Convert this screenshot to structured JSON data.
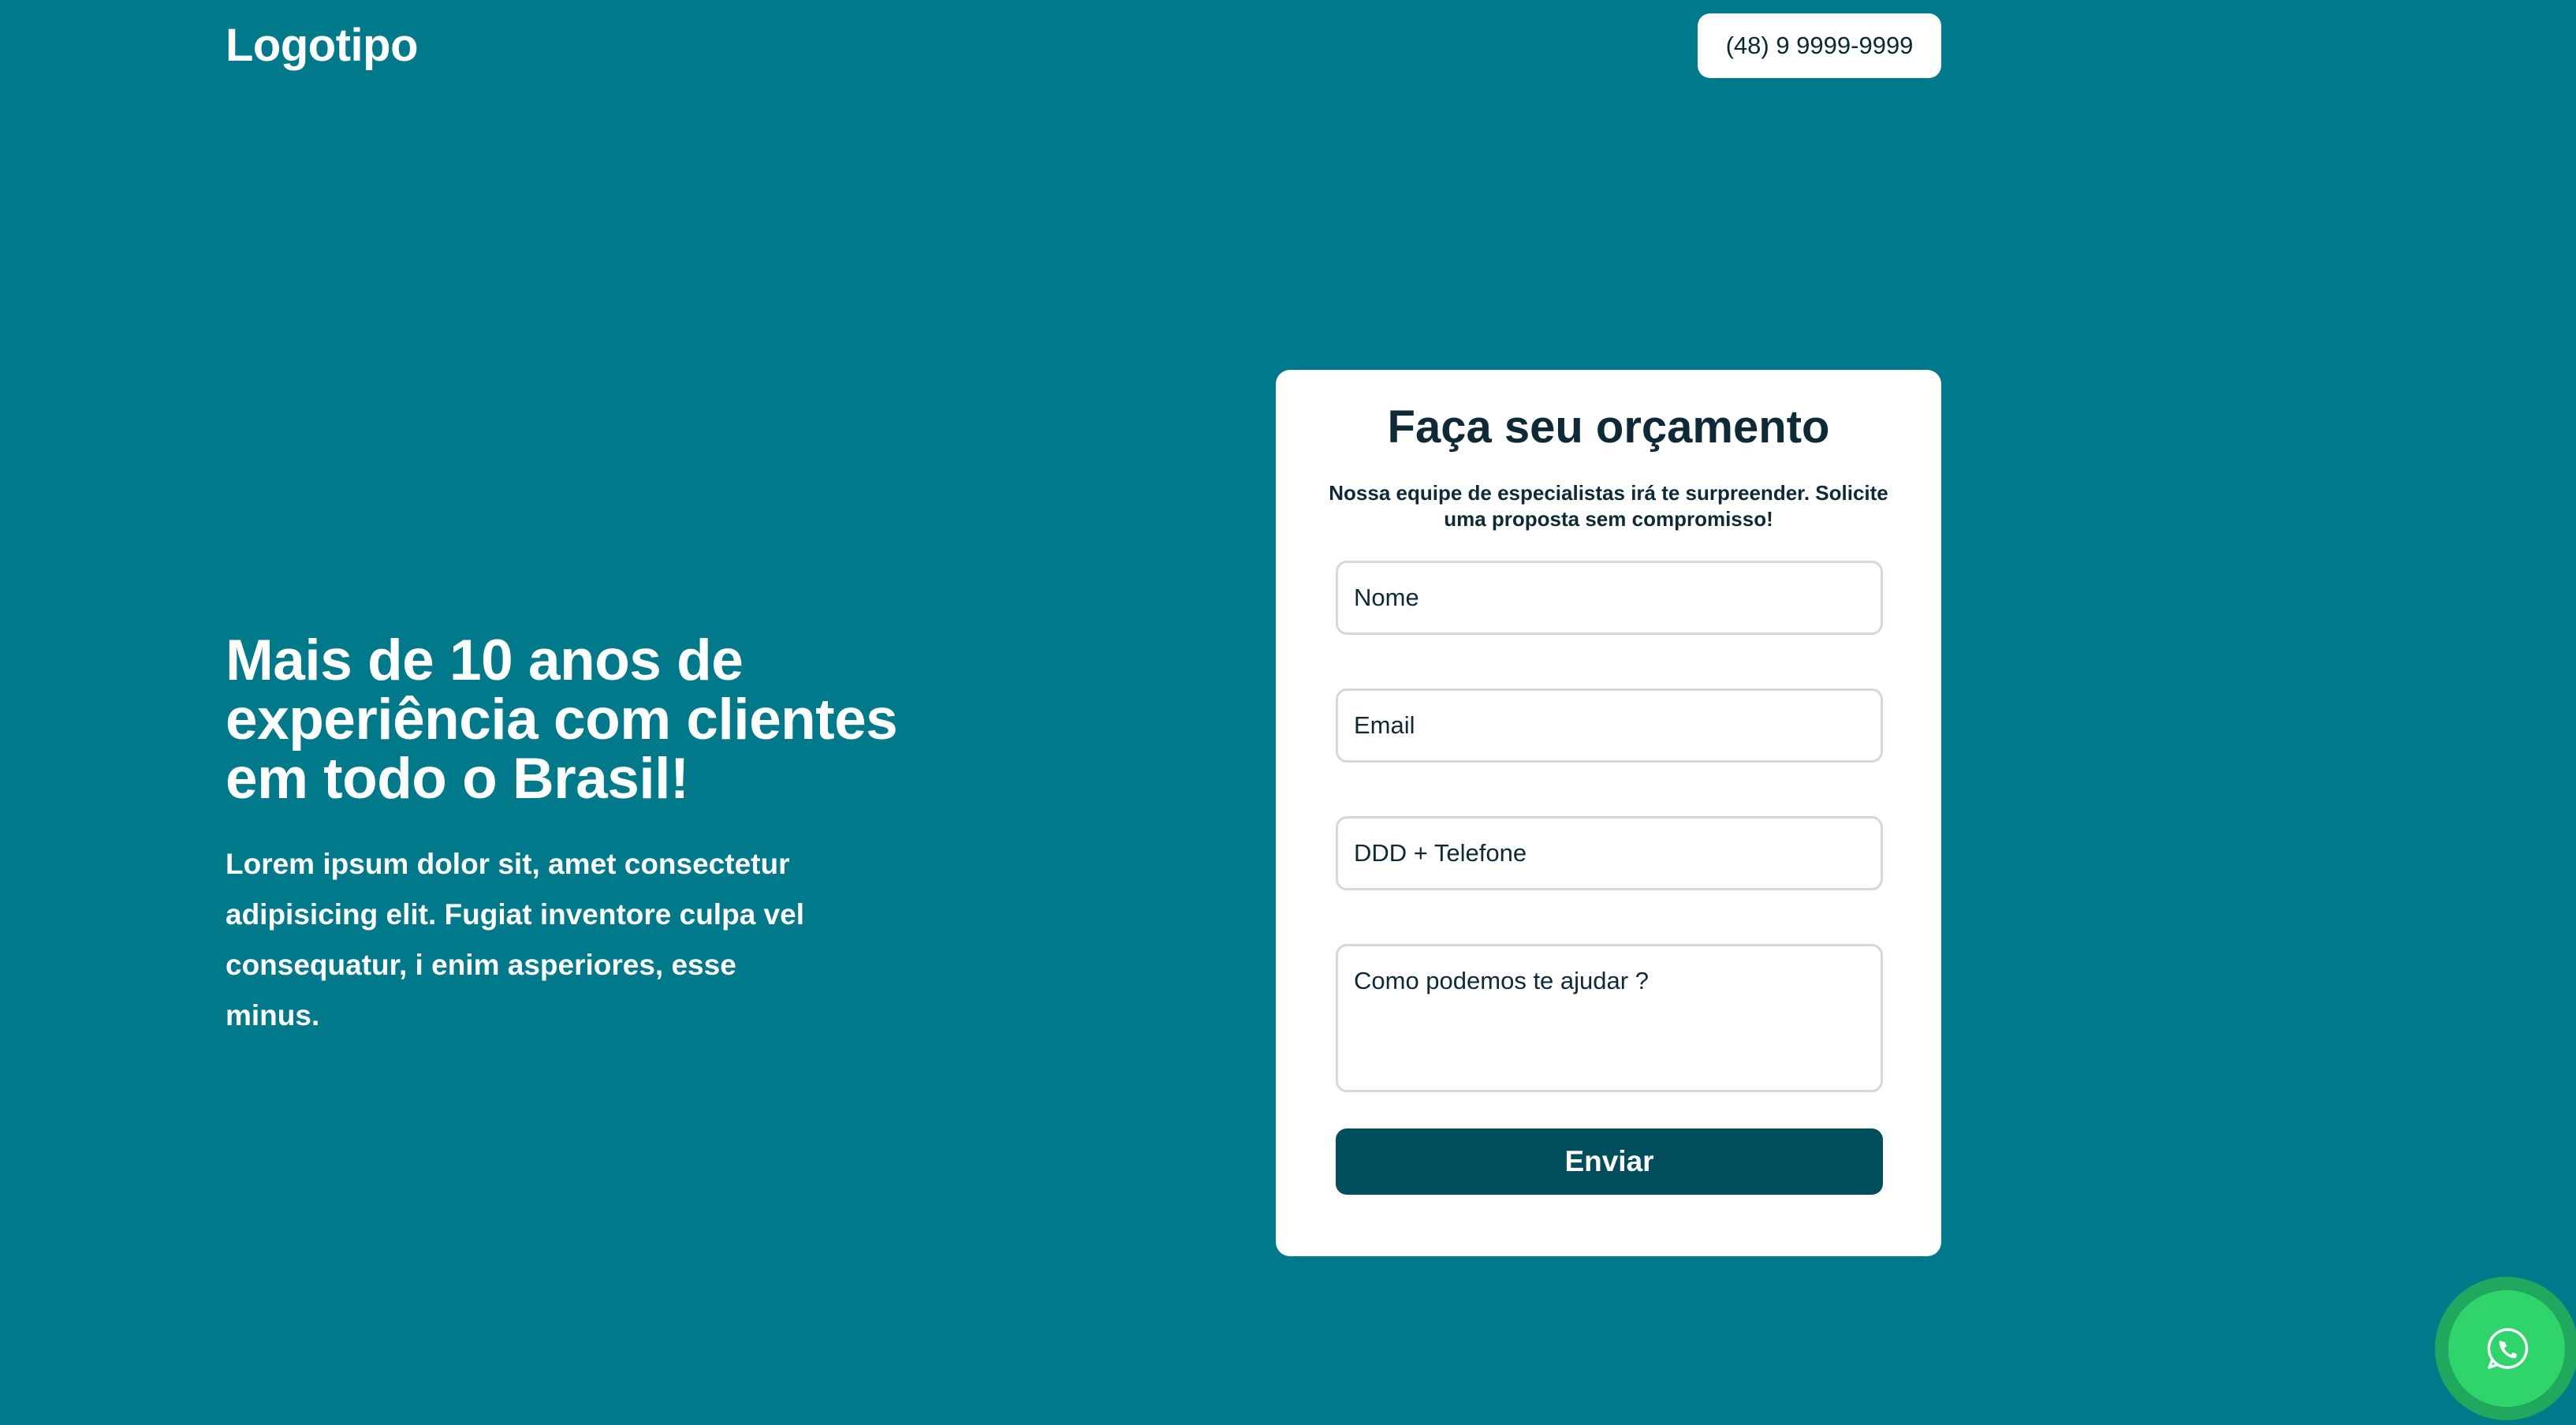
{
  "header": {
    "logo": "Logotipo",
    "phone": "(48) 9 9999-9999"
  },
  "hero": {
    "title": "Mais de 10 anos de experiência com clientes em todo o Brasil!",
    "text": "Lorem ipsum dolor sit, amet consectetur adipisicing elit. Fugiat inventore culpa vel consequatur, i enim asperiores, esse minus."
  },
  "form": {
    "title": "Faça seu orçamento",
    "subtitle": "Nossa equipe de especialistas irá te surpreender. Solicite uma proposta sem compromisso!",
    "name_placeholder": "Nome",
    "email_placeholder": "Email",
    "phone_placeholder": "DDD + Telefone",
    "message_placeholder": "Como podemos te ajudar ?",
    "submit_label": "Enviar"
  },
  "floating": {
    "icon": "whatsapp-icon"
  },
  "colors": {
    "background": "#00798A",
    "button_dark": "#004D5E",
    "whatsapp": "#2FD46A"
  }
}
